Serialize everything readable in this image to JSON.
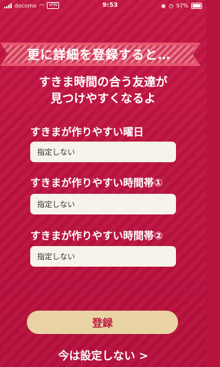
{
  "status_bar": {
    "carrier": "docomo",
    "vpn": "VPN",
    "time": "9:53",
    "battery": "97%",
    "icons": [
      "signal-icon",
      "wifi-icon",
      "vpn-icon",
      "lock-rotation-icon",
      "alarm-icon",
      "battery-icon"
    ]
  },
  "banner": {
    "title": "更に詳細を登録すると…"
  },
  "lead": {
    "line1": "すきま時間の合う友達が",
    "line2": "見つけやすくなるよ"
  },
  "fields": [
    {
      "label": "すきまが作りやすい曜日",
      "value": "指定しない"
    },
    {
      "label": "すきまが作りやすい時間帯①",
      "value": "指定しない"
    },
    {
      "label": "すきまが作りやすい時間帯②",
      "value": "指定しない"
    }
  ],
  "actions": {
    "register": "登録",
    "skip": "今は設定しない >"
  },
  "colors": {
    "background": "#b8123f",
    "banner": "#d63a59",
    "field": "#f7f2ea",
    "button": "#e9d3a4",
    "button_text": "#c0173f"
  }
}
